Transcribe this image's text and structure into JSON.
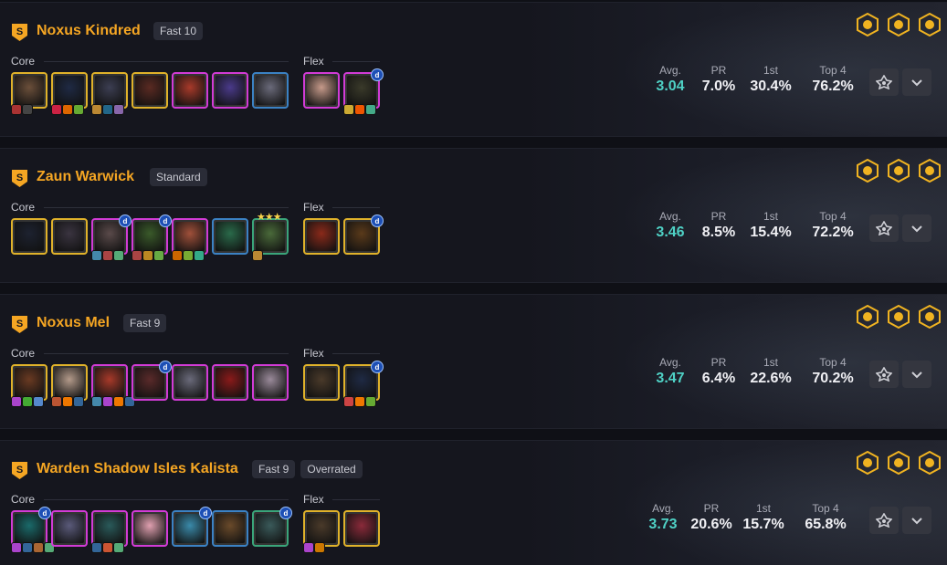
{
  "labels": {
    "core": "Core",
    "flex": "Flex",
    "avg": "Avg.",
    "pr": "PR",
    "first": "1st",
    "top4": "Top 4"
  },
  "colors": {
    "tier_gold": "#f5a623",
    "avg_teal": "#4fd1c5"
  },
  "comps": [
    {
      "name": "Noxus Kindred",
      "tags": [
        "Fast 10"
      ],
      "traits": [
        "noxus-trait-icon",
        "beast-trait-icon",
        "warden-trait-icon"
      ],
      "core": [
        {
          "tint": "#6b4f3a",
          "cost": 5,
          "items": [
            "#a33",
            "#444"
          ]
        },
        {
          "tint": "#1f2a44",
          "cost": 5,
          "items": [
            "#c24",
            "#d60",
            "#6a3"
          ]
        },
        {
          "tint": "#3c3e52",
          "cost": 5,
          "items": [
            "#b83",
            "#268",
            "#86a"
          ]
        },
        {
          "tint": "#5a2a22",
          "cost": 5,
          "items": []
        },
        {
          "tint": "#a83a2a",
          "cost": 4,
          "items": []
        },
        {
          "tint": "#4a3a8a",
          "cost": 4,
          "items": []
        },
        {
          "tint": "#6a6a7a",
          "cost": 3,
          "items": []
        }
      ],
      "flex": [
        {
          "tint": "#c69a8a",
          "cost": 4,
          "items": []
        },
        {
          "tint": "#3a3a2a",
          "cost": 4,
          "items": [
            "#ca3",
            "#e50",
            "#4a8"
          ],
          "duplicator": true
        }
      ],
      "stats": {
        "avg": "3.04",
        "pr": "7.0%",
        "first": "30.4%",
        "top4": "76.2%"
      }
    },
    {
      "name": "Zaun Warwick",
      "tags": [
        "Standard"
      ],
      "traits": [
        "zaun-trait-icon",
        "brawler-trait-icon",
        "beast-trait-icon"
      ],
      "core": [
        {
          "tint": "#1d2230",
          "cost": 5,
          "items": []
        },
        {
          "tint": "#3a3440",
          "cost": 5,
          "items": []
        },
        {
          "tint": "#5a4a4a",
          "cost": 4,
          "items": [
            "#48a",
            "#a44",
            "#5a7"
          ],
          "duplicator": true
        },
        {
          "tint": "#3a5a2a",
          "cost": 4,
          "items": [
            "#a44",
            "#b82",
            "#6a4"
          ],
          "duplicator": true
        },
        {
          "tint": "#a0503a",
          "cost": 4,
          "items": [
            "#c60",
            "#7a3",
            "#3a8"
          ]
        },
        {
          "tint": "#2a6a4a",
          "cost": 3,
          "items": []
        },
        {
          "tint": "#4a6a3a",
          "cost": 2,
          "items": [
            "#b83"
          ],
          "stars": "★★★"
        }
      ],
      "flex": [
        {
          "tint": "#8a2a1a",
          "cost": 5,
          "items": []
        },
        {
          "tint": "#5a3a1a",
          "cost": 5,
          "items": [],
          "duplicator": true
        }
      ],
      "stats": {
        "avg": "3.46",
        "pr": "8.5%",
        "first": "15.4%",
        "top4": "72.2%"
      }
    },
    {
      "name": "Noxus Mel",
      "tags": [
        "Fast 9"
      ],
      "traits": [
        "noxus-trait-icon",
        "prismatic-trait-icon",
        "conjurer-trait-icon"
      ],
      "core": [
        {
          "tint": "#6a3a22",
          "cost": 5,
          "items": [
            "#a4c",
            "#4a3",
            "#58c"
          ]
        },
        {
          "tint": "#b39a8a",
          "cost": 5,
          "items": [
            "#b53",
            "#e70",
            "#369"
          ]
        },
        {
          "tint": "#a83a2a",
          "cost": 4,
          "items": [
            "#48a",
            "#a4c",
            "#e70",
            "#369"
          ]
        },
        {
          "tint": "#5a2a2a",
          "cost": 4,
          "items": [],
          "duplicator": true
        },
        {
          "tint": "#6a6a7a",
          "cost": 4,
          "items": []
        },
        {
          "tint": "#8a1a1a",
          "cost": 4,
          "items": []
        },
        {
          "tint": "#9a8a9a",
          "cost": 4,
          "items": []
        }
      ],
      "flex": [
        {
          "tint": "#4a3a2a",
          "cost": 5,
          "items": []
        },
        {
          "tint": "#1f2a44",
          "cost": 5,
          "items": [
            "#c44",
            "#e70",
            "#6a3"
          ],
          "duplicator": true
        }
      ],
      "stats": {
        "avg": "3.47",
        "pr": "6.4%",
        "first": "22.6%",
        "top4": "70.2%"
      }
    },
    {
      "name": "Warden Shadow Isles Kalista",
      "tags": [
        "Fast 9",
        "Overrated"
      ],
      "traits": [
        "warden-trait-icon",
        "shadow-isles-trait-icon",
        "emissary-trait-icon"
      ],
      "core": [
        {
          "tint": "#1a6a6a",
          "cost": 4,
          "items": [
            "#a4c",
            "#369",
            "#a63",
            "#5a7"
          ],
          "duplicator": true
        },
        {
          "tint": "#5a5a7a",
          "cost": 4,
          "items": []
        },
        {
          "tint": "#2a5a5a",
          "cost": 4,
          "items": [
            "#369",
            "#c53",
            "#5a7"
          ]
        },
        {
          "tint": "#e0a0b0",
          "cost": 4,
          "items": []
        },
        {
          "tint": "#3a8aaa",
          "cost": 3,
          "items": [],
          "duplicator": true
        },
        {
          "tint": "#6a4a2a",
          "cost": 3,
          "items": []
        },
        {
          "tint": "#3a5a5a",
          "cost": 2,
          "items": [],
          "duplicator": true
        }
      ],
      "flex": [
        {
          "tint": "#4a3a2a",
          "cost": 5,
          "items": [
            "#a4c",
            "#c70"
          ]
        },
        {
          "tint": "#8a2a3a",
          "cost": 5,
          "items": []
        }
      ],
      "stats": {
        "avg": "3.73",
        "pr": "20.6%",
        "first": "15.7%",
        "top4": "65.8%"
      }
    }
  ]
}
